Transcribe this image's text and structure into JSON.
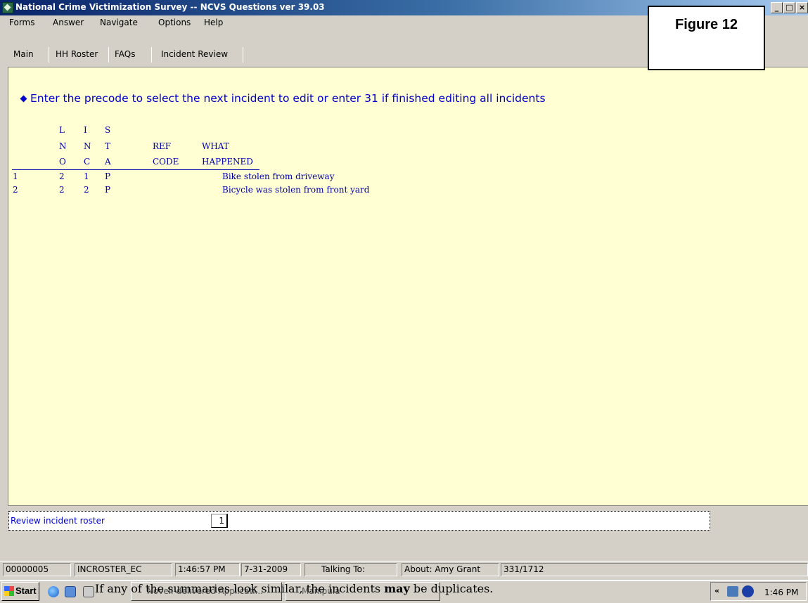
{
  "window": {
    "title": "National Crime Victimization Survey -- NCVS Questions ver 39.03",
    "controls": {
      "minimize": "_",
      "maximize": "□",
      "close": "×"
    }
  },
  "figure_label": "Figure 12",
  "menu": [
    "Forms",
    "Answer",
    "Navigate",
    "Options",
    "Help"
  ],
  "tabs": [
    "Main",
    "HH Roster",
    "FAQs",
    "Incident Review"
  ],
  "instruction": "Enter the precode to select the next incident to edit or enter 31 if finished editing all incidents",
  "roster": {
    "headers": {
      "row1": [
        "L",
        "I",
        "S",
        "",
        ""
      ],
      "row2": [
        "N",
        "N",
        "T",
        "REF",
        "WHAT"
      ],
      "row3": [
        "O",
        "C",
        "A",
        "CODE",
        "HAPPENED"
      ]
    },
    "rows": [
      {
        "num": "1",
        "lno": "2",
        "inc": "1",
        "sta": "P",
        "ref": "",
        "what": "Bike stolen from driveway"
      },
      {
        "num": "2",
        "lno": "2",
        "inc": "2",
        "sta": "P",
        "ref": "",
        "what": "Bicycle was stolen from front yard"
      }
    ]
  },
  "input": {
    "label": "Review incident roster",
    "value": "1"
  },
  "status": {
    "case_id": "00000005",
    "field": "INCROSTER_EC",
    "time": "1:46:57 PM",
    "date": "7-31-2009",
    "talking_to": "Talking To:",
    "about": "About: Amy Grant",
    "count": "331/1712"
  },
  "taskbar": {
    "start": "Start",
    "items": [
      "Novell-delivered Applicati...",
      "Manipula"
    ],
    "caption_prefix": "If any of the summaries look similar, the incidents ",
    "caption_bold": "may",
    "caption_suffix": " be duplicates.",
    "tray_arrow": "«",
    "clock": "1:46 PM"
  },
  "icons": [
    "app-icon",
    "ie-icon",
    "app-icon",
    "app-icon",
    "start-icon",
    "network-icon",
    "audio-icon"
  ]
}
